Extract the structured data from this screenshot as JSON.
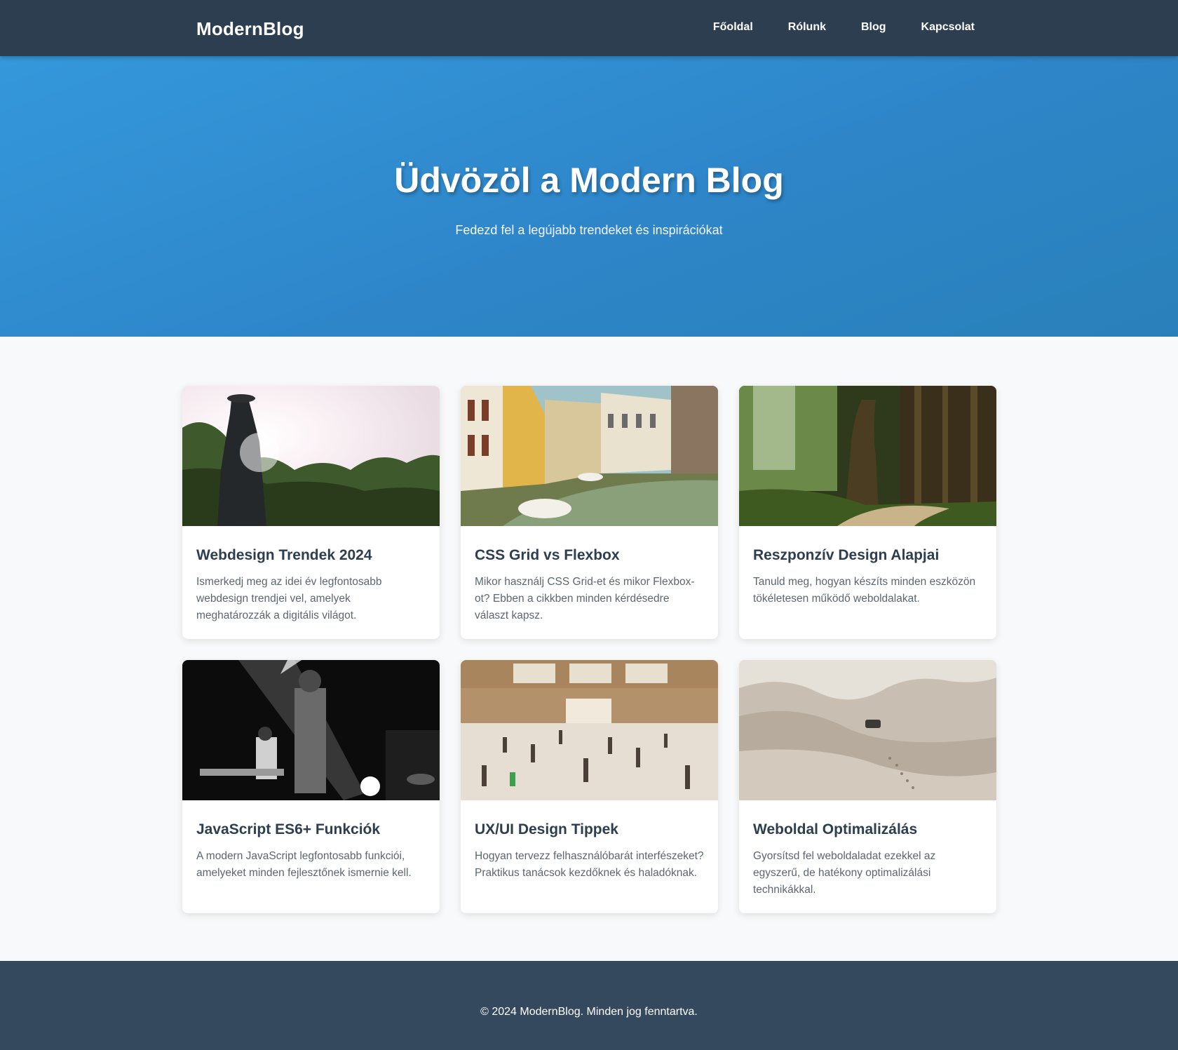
{
  "header": {
    "logo": "ModernBlog",
    "nav": [
      {
        "label": "Főoldal"
      },
      {
        "label": "Rólunk"
      },
      {
        "label": "Blog"
      },
      {
        "label": "Kapcsolat"
      }
    ]
  },
  "hero": {
    "title": "Üdvözöl a Modern Blog",
    "subtitle": "Fedezd fel a legújabb trendeket és inspirációkat"
  },
  "posts": [
    {
      "title": "Webdesign Trendek 2024",
      "excerpt": "Ismerkedj meg az idei év legfontosabb webdesign trendjei vel, amelyek meghatározzák a digitális világot.",
      "image": "man-in-sunlight-photo"
    },
    {
      "title": "CSS Grid vs Flexbox",
      "excerpt": "Mikor használj CSS Grid-et és mikor Flexbox-ot? Ebben a cikkben minden kérdésedre választ kapsz.",
      "image": "canal-houses-photo"
    },
    {
      "title": "Reszponzív Design Alapjai",
      "excerpt": "Tanuld meg, hogyan készíts minden eszközön tökéletesen működő weboldalakat.",
      "image": "forest-path-photo"
    },
    {
      "title": "JavaScript ES6+ Funkciók",
      "excerpt": "A modern JavaScript legfontosabb funkciói, amelyeket minden fejlesztőnek ismernie kell.",
      "image": "concert-stage-photo"
    },
    {
      "title": "UX/UI Design Tippek",
      "excerpt": "Hogyan tervezz felhasználóbarát interfészeket? Praktikus tanácsok kezdőknek és haladóknak.",
      "image": "train-station-crowd-photo"
    },
    {
      "title": "Weboldal Optimalizálás",
      "excerpt": "Gyorsítsd fel weboldaladat ezekkel az egyszerű, de hatékony optimalizálási technikákkal.",
      "image": "desert-dunes-photo"
    }
  ],
  "footer": {
    "text": "© 2024 ModernBlog. Minden jog fenntartva."
  },
  "colors": {
    "header_bg": "#2c3e50",
    "hero_gradient_start": "#3498db",
    "hero_gradient_end": "#2980b9",
    "page_bg": "#f8f9fa",
    "footer_bg": "#34495e"
  }
}
